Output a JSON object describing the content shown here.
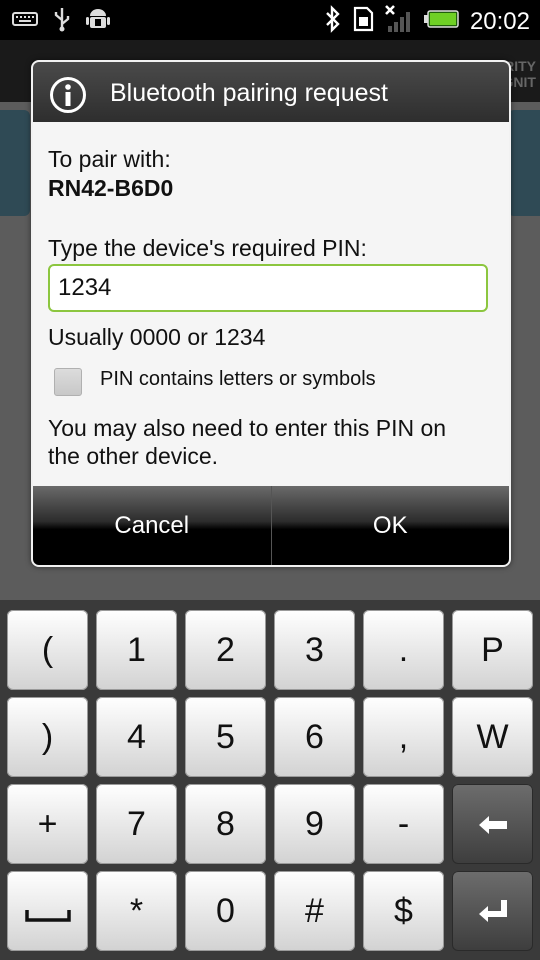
{
  "status_bar": {
    "time": "20:02",
    "icons": [
      "keyboard-icon",
      "usb-icon",
      "android-debug-icon",
      "bluetooth-icon",
      "sd-card-icon",
      "signal-icon",
      "battery-icon"
    ]
  },
  "background_app": {
    "header_text_line1": "ERITY",
    "header_text_line2": "GNIT"
  },
  "dialog": {
    "title": "Bluetooth pairing request",
    "pair_with_label": "To pair with:",
    "device_name": "RN42-B6D0",
    "pin_prompt": "Type the device's required PIN:",
    "pin_value": "1234",
    "pin_hint": "Usually 0000 or 1234",
    "checkbox_label": "PIN contains letters or symbols",
    "checkbox_checked": false,
    "note_line1": "You may also need to enter this PIN on",
    "note_line2": "the other device.",
    "cancel_label": "Cancel",
    "ok_label": "OK"
  },
  "keyboard": {
    "rows": [
      [
        "(",
        "1",
        "2",
        "3",
        ".",
        "P"
      ],
      [
        ")",
        "4",
        "5",
        "6",
        ",",
        "W"
      ],
      [
        "+",
        "7",
        "8",
        "9",
        "-",
        "backspace"
      ],
      [
        "space",
        "*",
        "0",
        "#",
        "$",
        "enter"
      ]
    ]
  },
  "colors": {
    "accent_green": "#8cc63f",
    "title_bar": "#3a3a3a"
  }
}
